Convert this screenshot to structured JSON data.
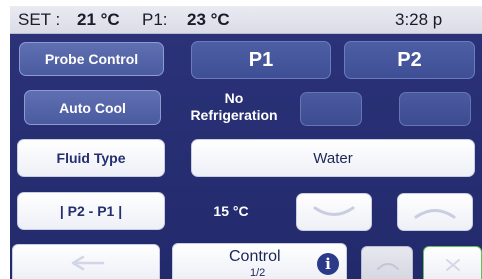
{
  "status": {
    "set_label": "SET :",
    "set_value": "21 °C",
    "p1_label": "P1:",
    "p1_value": "23 °C",
    "time": "3:28 p"
  },
  "buttons": {
    "probe_control": "Probe Control",
    "p1": "P1",
    "p2": "P2",
    "auto_cool": "Auto Cool",
    "refrigeration": "No\nRefrigeration",
    "fluid_type": "Fluid Type",
    "fluid_value": "Water",
    "p2_p1": "| P2 - P1 |",
    "delta_value": "15 °C"
  },
  "bottom_nav": {
    "control_label": "Control",
    "page_indicator": "1/2",
    "info_glyph": "i"
  },
  "colors": {
    "panel": "#262e72",
    "button_blue": "#5565a8",
    "button_white": "#ffffff",
    "status_bar": "#e2e2ec",
    "accent_green": "#61c25b"
  },
  "icons": {
    "back": "left-arrow-icon",
    "decrease": "down-chevron-icon",
    "increase": "up-chevron-icon",
    "info": "info-icon",
    "close": "close-icon"
  }
}
